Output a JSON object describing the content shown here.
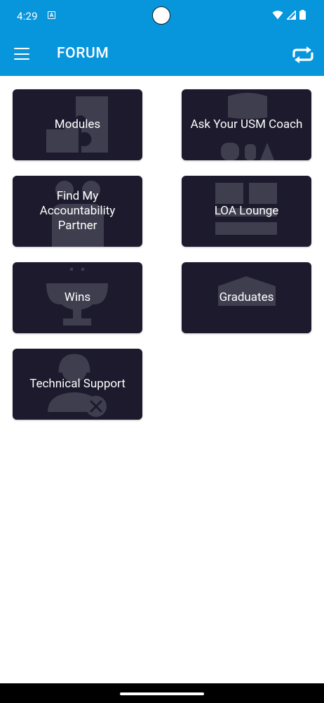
{
  "status_bar": {
    "time": "4:29",
    "notification_icon": "app-notification-icon",
    "icons": [
      "wifi-icon",
      "cell-signal-icon",
      "battery-icon"
    ]
  },
  "header": {
    "title": "FORUM",
    "menu_icon": "hamburger-menu-icon",
    "action_icon": "sync-icon"
  },
  "tiles": [
    {
      "label": "Modules",
      "icon": "puzzle-icon"
    },
    {
      "label": "Ask Your USM Coach",
      "icon": "qa-icon"
    },
    {
      "label": "Find My Accountability Partner",
      "icon": "partners-icon"
    },
    {
      "label": "LOA Lounge",
      "icon": "lounge-icon"
    },
    {
      "label": "Wins",
      "icon": "trophy-icon"
    },
    {
      "label": "Graduates",
      "icon": "graduation-cap-icon"
    },
    {
      "label": "Technical Support",
      "icon": "support-agent-icon"
    }
  ],
  "colors": {
    "header": "#0795dc",
    "tile": "#1c1a2c",
    "tile_icon": "#3f3e4f",
    "background": "#ffffff"
  }
}
